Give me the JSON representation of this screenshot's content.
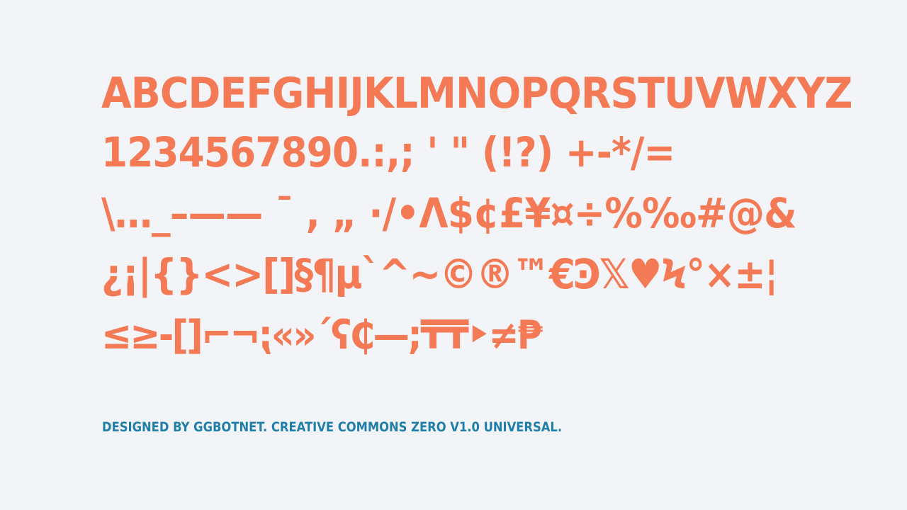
{
  "specimen": {
    "lines": [
      "ABCDEFGHIJKLMNOPQRSTUVWXYZ",
      "1234567890.:,; ' \" (!?) +-*/=",
      "\\…_–—— ¯ , „ ·/•Λ$¢£¥¤÷%‰#@&",
      "¿¡|{}<>[]§¶µ`^~©®™€Ͽ𝕏♥Ϟ°×±¦",
      "≤≥-[]⌐¬⁏«»´ʕ₵—;₸₸‣≠₱"
    ],
    "text_color": "#f47a56"
  },
  "credit": {
    "text": "DESIGNED BY GGBOTNET. CREATIVE COMMONS ZERO V1.0 UNIVERSAL.",
    "color": "#1f7fa8"
  },
  "background_color": "#f3f4f8"
}
